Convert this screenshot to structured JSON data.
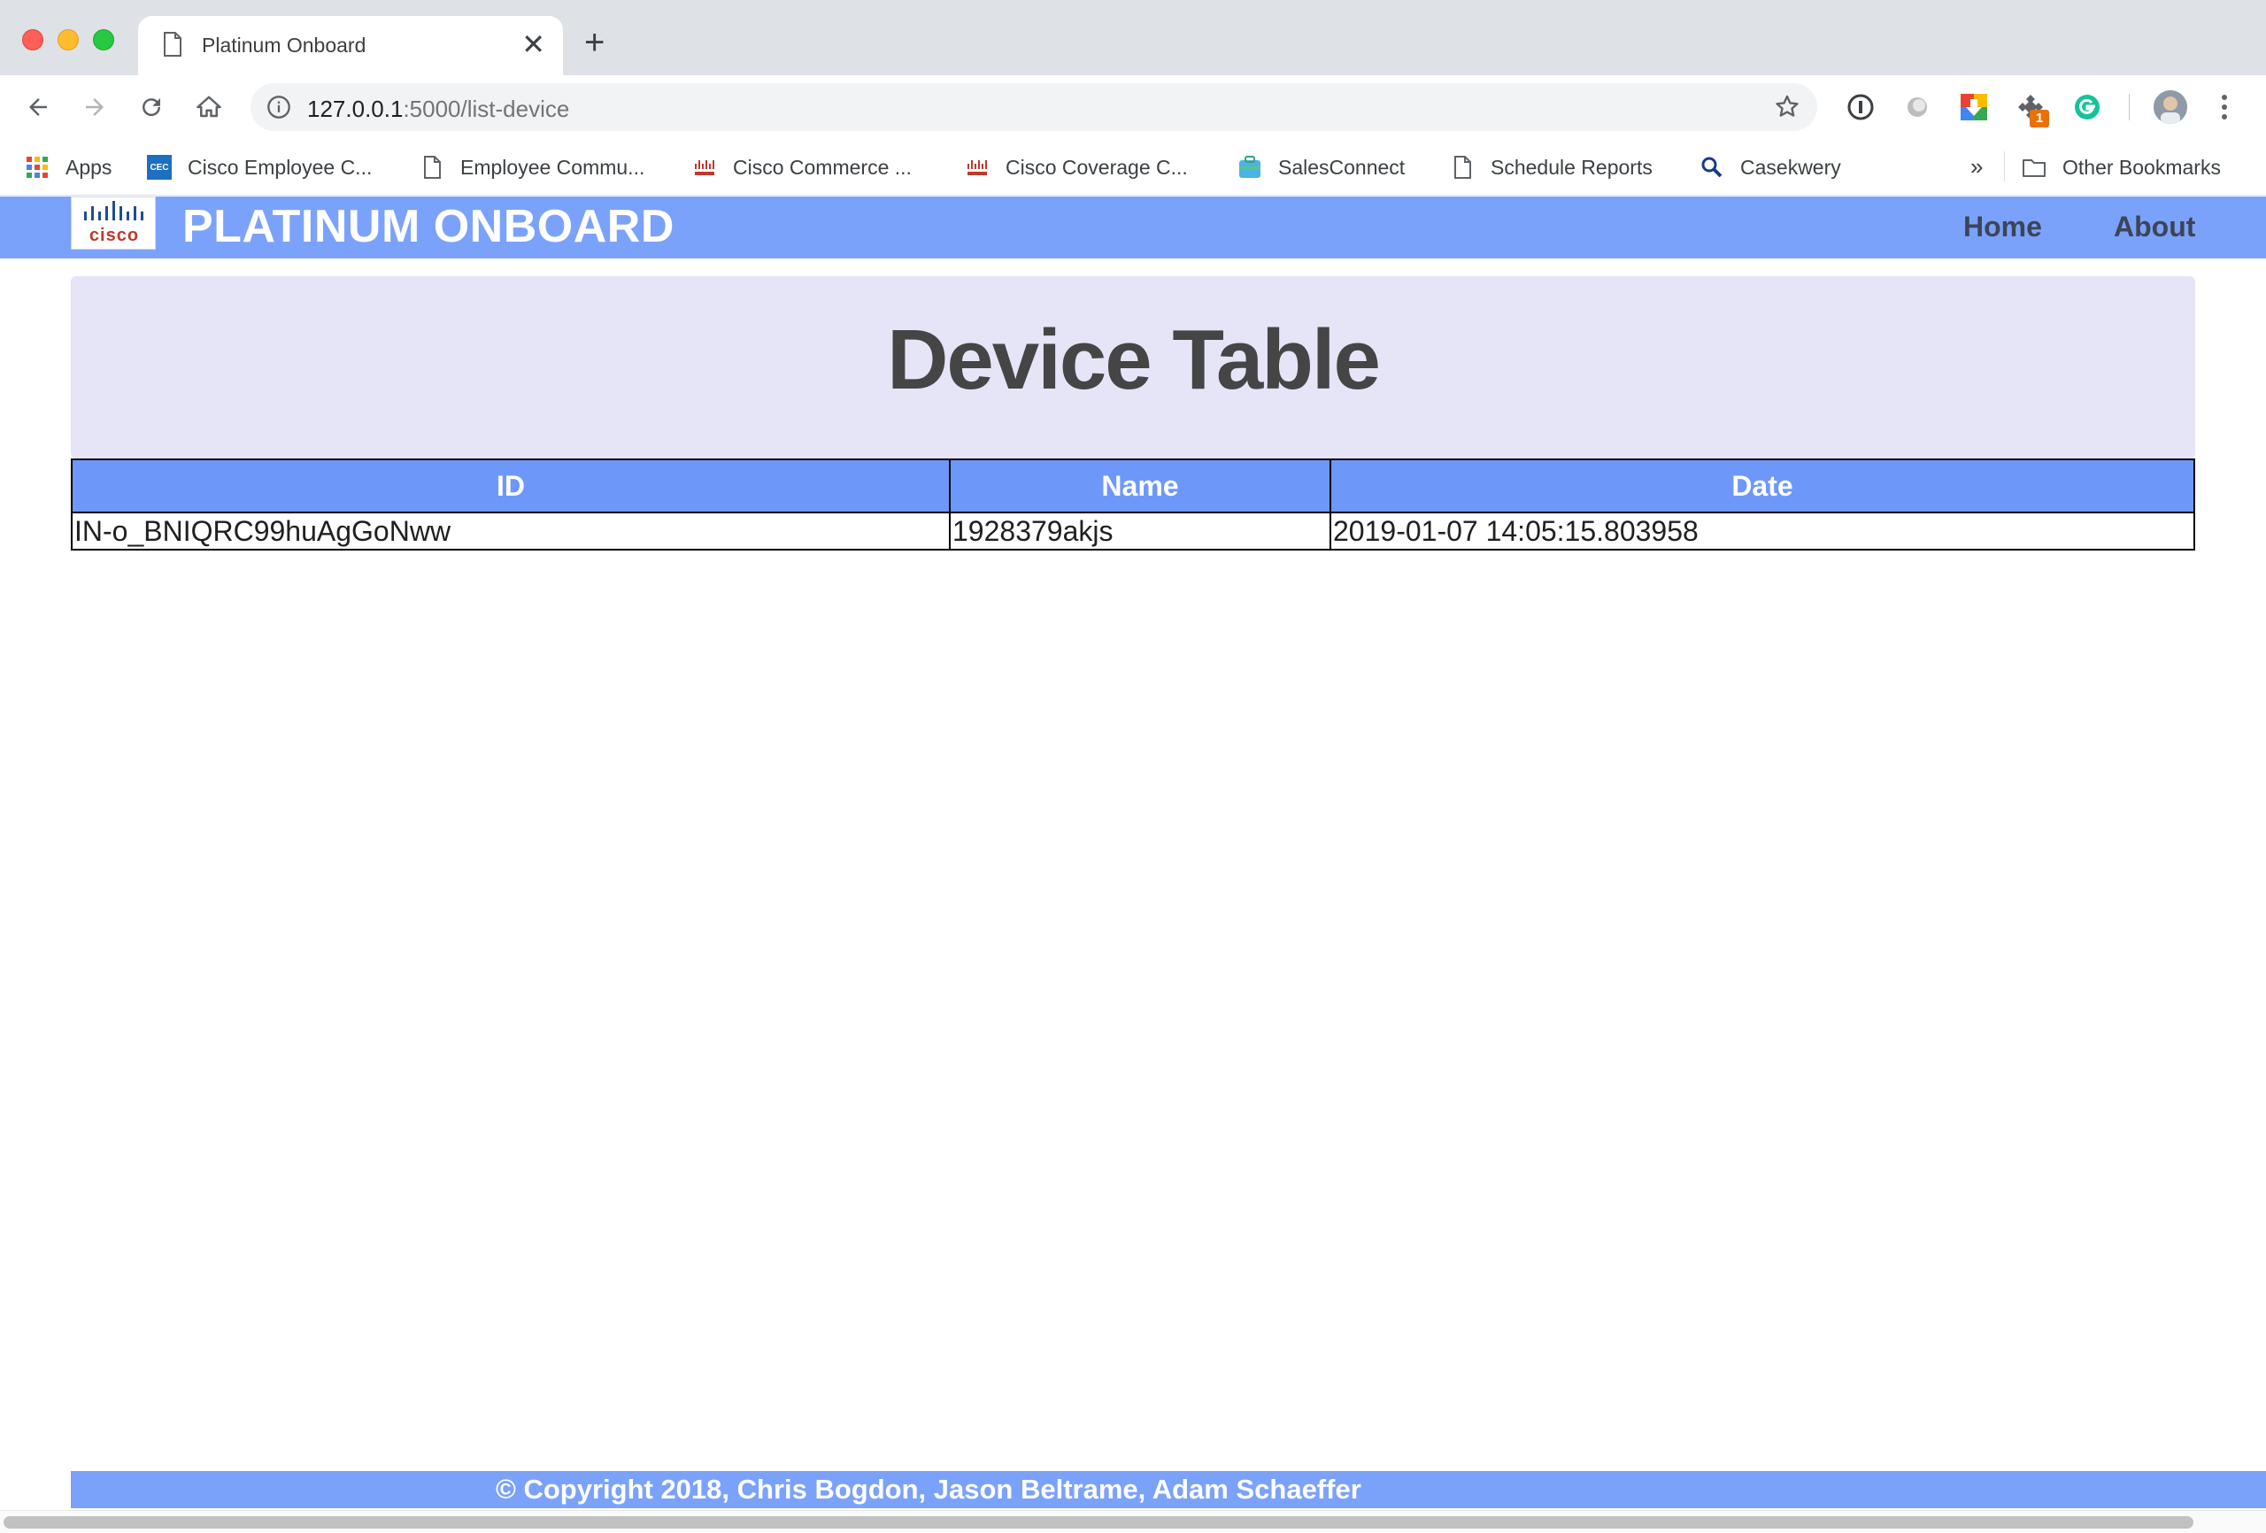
{
  "browser": {
    "tab_title": "Platinum Onboard",
    "new_tab_label": "+",
    "url_host": "127.0.0.1",
    "url_path": ":5000/list-device",
    "extension_badge": "1",
    "bookmarks": [
      {
        "label": "Apps",
        "icon": "apps-grid-icon"
      },
      {
        "label": "Cisco Employee C...",
        "icon": "cec-icon"
      },
      {
        "label": "Employee Commu...",
        "icon": "page-icon"
      },
      {
        "label": "Cisco Commerce ...",
        "icon": "cisco-icon"
      },
      {
        "label": "Cisco Coverage C...",
        "icon": "cisco-icon"
      },
      {
        "label": "SalesConnect",
        "icon": "salesconnect-icon"
      },
      {
        "label": "Schedule Reports",
        "icon": "page-icon"
      },
      {
        "label": "Casekwery",
        "icon": "search-icon"
      }
    ],
    "bookmarks_overflow": "»",
    "other_bookmarks": "Other Bookmarks"
  },
  "site": {
    "logo_text": "cisco",
    "brand": "PLATINUM ONBOARD",
    "nav": {
      "home": "Home",
      "about": "About"
    },
    "page_title": "Device Table",
    "table": {
      "headers": [
        "ID",
        "Name",
        "Date"
      ],
      "rows": [
        [
          "IN-o_BNIQRC99huAgGoNww",
          "1928379akjs",
          "2019-01-07 14:05:15.803958"
        ]
      ]
    },
    "footer": "© Copyright 2018, Chris Bogdon, Jason Beltrame, Adam Schaeffer"
  },
  "colors": {
    "navbar": "#7ba2fb",
    "table_header": "#6d98fa",
    "jumbotron": "#e5e5f7",
    "title_text": "#454545"
  }
}
